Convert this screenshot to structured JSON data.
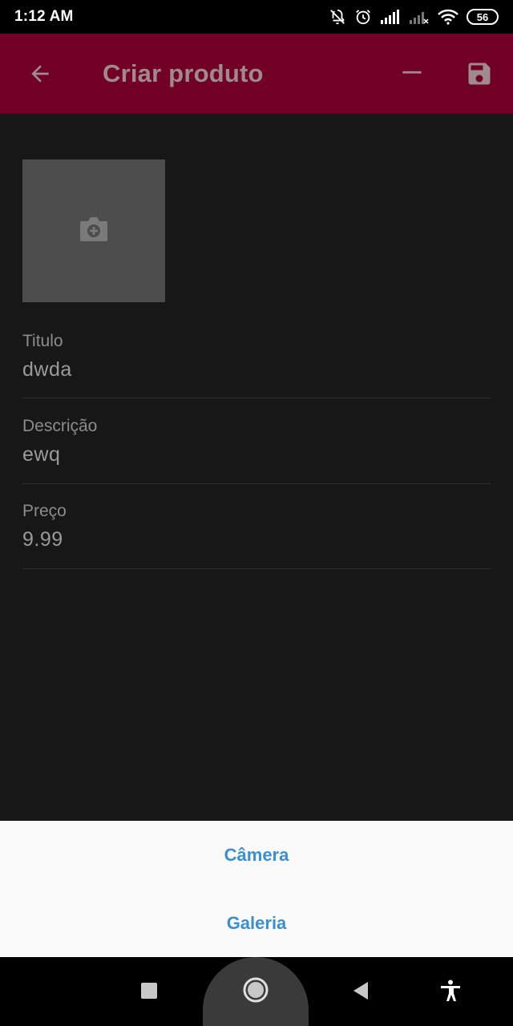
{
  "status_bar": {
    "time": "1:12 AM",
    "battery": "56",
    "icons": [
      "alarm-off-icon",
      "alarm-clock-icon",
      "signal-icon",
      "signal-weak-icon",
      "wifi-icon",
      "battery-icon"
    ]
  },
  "app_bar": {
    "title": "Criar produto",
    "background": "#720026",
    "icons": [
      "back-arrow-icon",
      "minus-icon",
      "save-icon"
    ]
  },
  "image_picker": {
    "icon": "add-photo-camera-icon"
  },
  "form": {
    "title": {
      "label": "Titulo",
      "value": "dwda"
    },
    "description": {
      "label": "Descrição",
      "value": "ewq"
    },
    "price": {
      "label": "Preço",
      "value": "9.99"
    }
  },
  "sheet": {
    "camera_label": "Câmera",
    "gallery_label": "Galeria",
    "accent": "#3a8fd2"
  },
  "nav_bar": {
    "icons": [
      "recents-square-icon",
      "home-circle-icon",
      "back-triangle-icon",
      "accessibility-icon"
    ]
  }
}
